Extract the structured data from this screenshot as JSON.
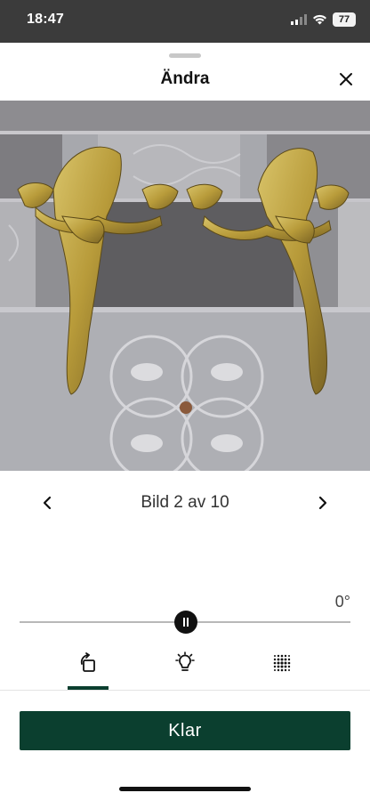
{
  "status_bar": {
    "time": "18:47",
    "battery": "77",
    "icons": [
      "signal-icon",
      "wifi-icon",
      "battery-icon"
    ]
  },
  "sheet": {
    "title": "Ändra",
    "close_icon": "close-icon"
  },
  "photo": {
    "content": "brass-wall-sconces-photo"
  },
  "pager": {
    "label": "Bild 2 av 10",
    "prev_icon": "chevron-left-icon",
    "next_icon": "chevron-right-icon"
  },
  "rotation": {
    "angle_label": "0°",
    "slider_value": 0.5
  },
  "tools": [
    {
      "name": "rotate",
      "icon": "rotate-icon",
      "active": true
    },
    {
      "name": "light",
      "icon": "lightbulb-icon",
      "active": false
    },
    {
      "name": "filter",
      "icon": "dots-filter-icon",
      "active": false
    }
  ],
  "done_button": {
    "label": "Klar"
  },
  "colors": {
    "accent": "#0b3f2f",
    "status_bar": "#3b3b3b"
  }
}
